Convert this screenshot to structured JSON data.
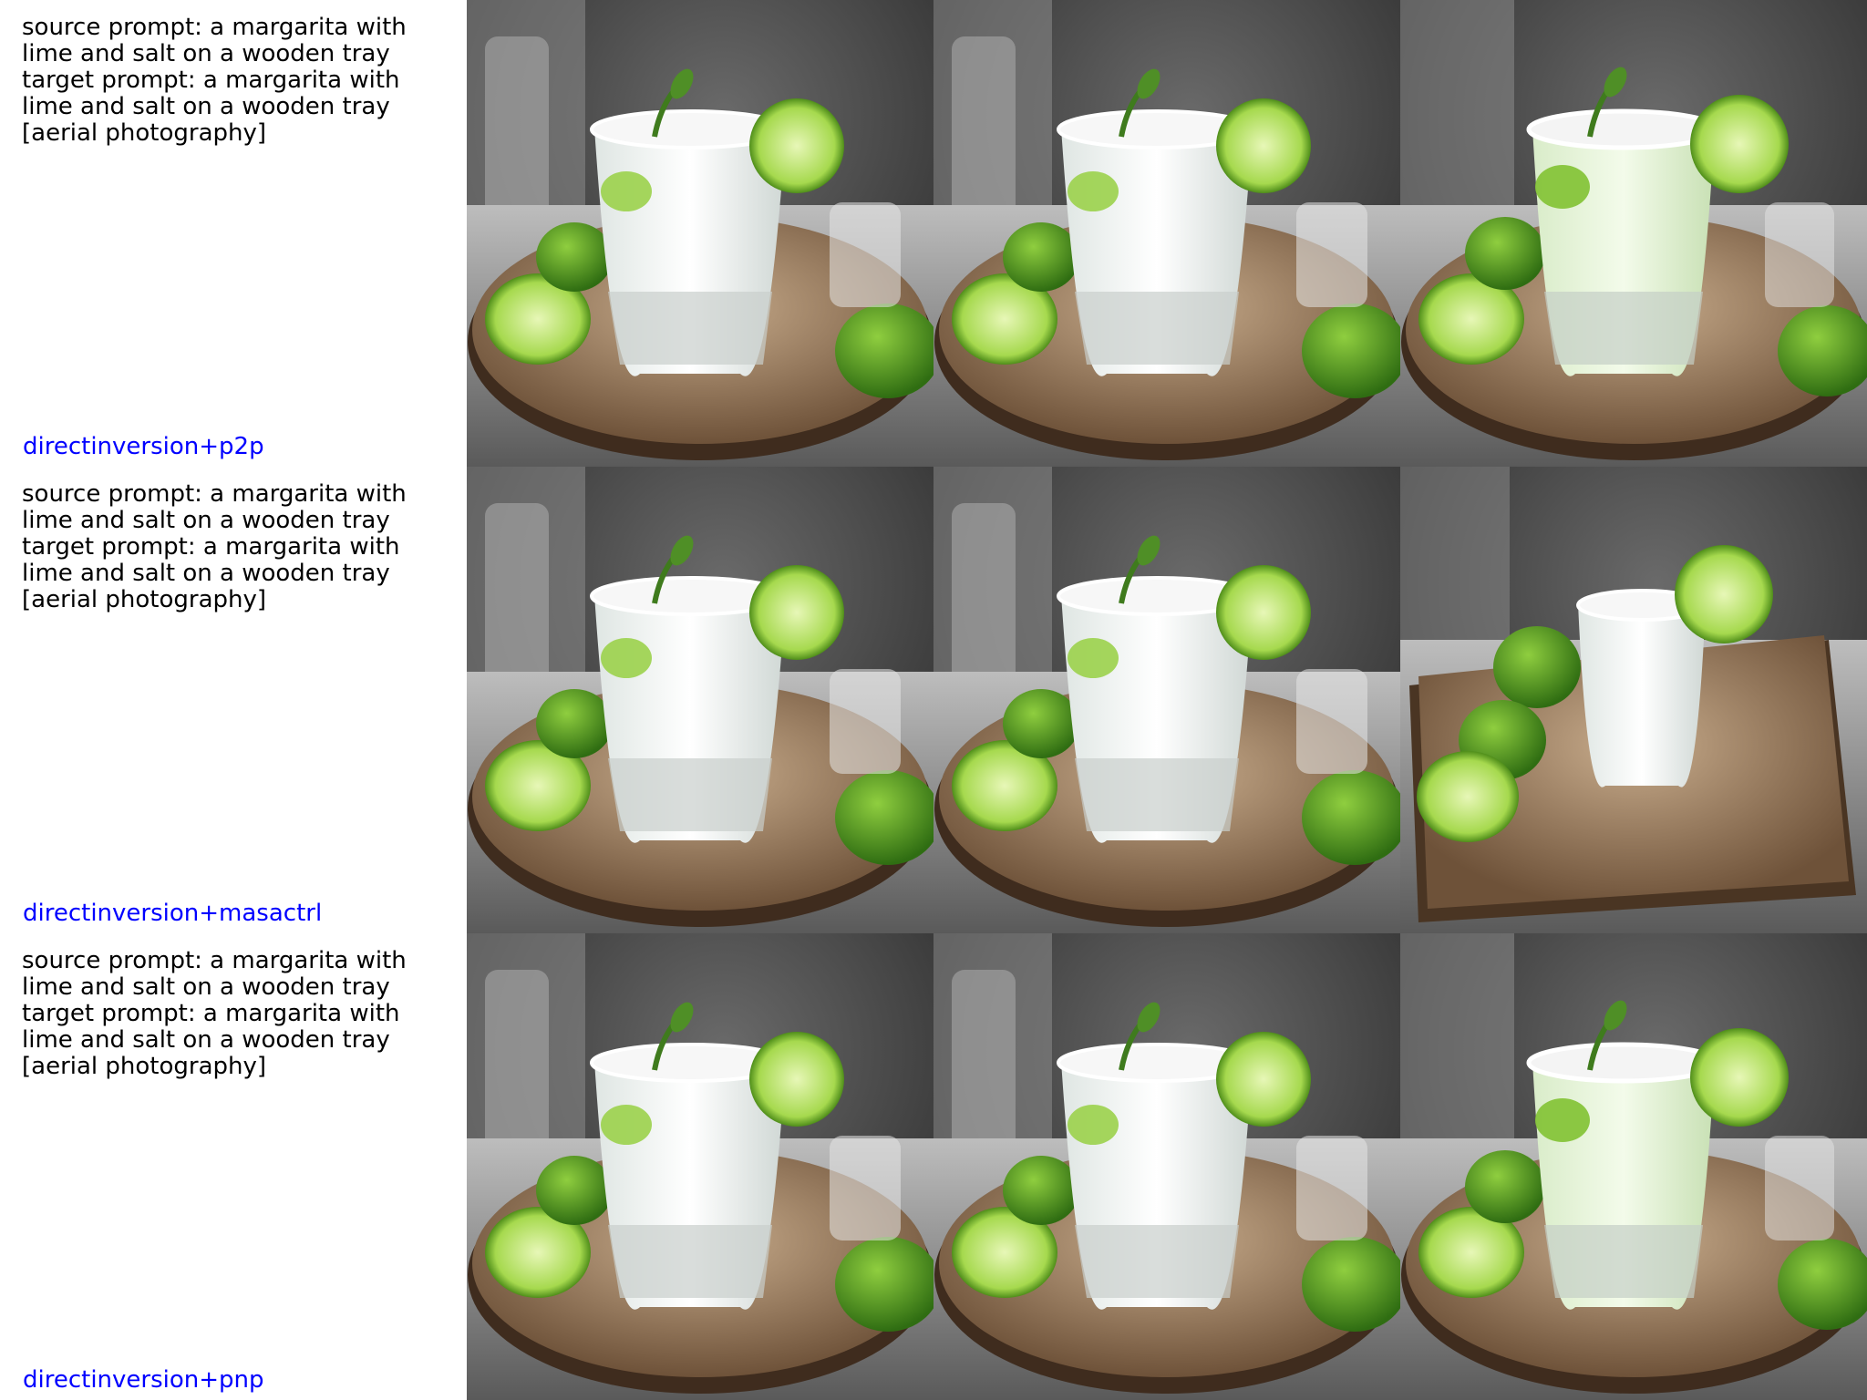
{
  "rows": [
    {
      "source_text": "source prompt: a margarita with lime and salt on a wooden tray",
      "target_text": "target prompt: a margarita with lime and salt on a wooden tray [aerial photography]",
      "method": "directinversion+p2p",
      "method_color": "#0000ff"
    },
    {
      "source_text": "source prompt: a margarita with lime and salt on a wooden tray",
      "target_text": "target prompt: a margarita with lime and salt on a wooden tray [aerial photography]",
      "method": "directinversion+masactrl",
      "method_color": "#0000ff"
    },
    {
      "source_text": "source prompt: a margarita with lime and salt on a wooden tray",
      "target_text": "target prompt: a margarita with lime and salt on a wooden tray [aerial photography]",
      "method": "directinversion+pnp",
      "method_color": "#0000ff"
    }
  ],
  "image_columns": [
    "source-image",
    "reconstruction-image",
    "edited-image"
  ]
}
